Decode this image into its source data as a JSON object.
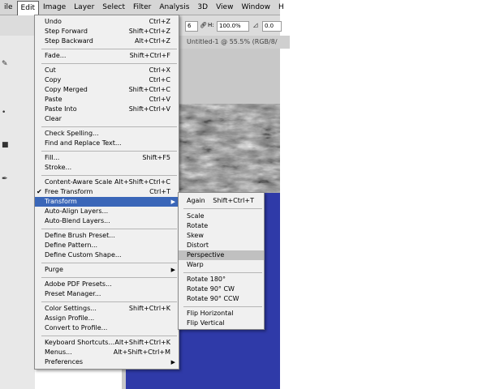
{
  "menubar": {
    "items": [
      {
        "label": "ile"
      },
      {
        "label": "Edit",
        "active": true
      },
      {
        "label": "Image"
      },
      {
        "label": "Layer"
      },
      {
        "label": "Select"
      },
      {
        "label": "Filter"
      },
      {
        "label": "Analysis"
      },
      {
        "label": "3D"
      },
      {
        "label": "View"
      },
      {
        "label": "Window"
      },
      {
        "label": "H"
      }
    ]
  },
  "options": {
    "w_value": "6",
    "h_label": "H:",
    "h_value": "100.0%",
    "angle_value": "0.0"
  },
  "document": {
    "title": "Untitled-1 @ 55.5% (RGB/8/"
  },
  "edit_menu": {
    "items": [
      {
        "label": "Undo",
        "shortcut": "Ctrl+Z"
      },
      {
        "label": "Step Forward",
        "shortcut": "Shift+Ctrl+Z"
      },
      {
        "label": "Step Backward",
        "shortcut": "Alt+Ctrl+Z"
      },
      {
        "label": "Fade...",
        "shortcut": "Shift+Ctrl+F"
      },
      {
        "label": "Cut",
        "shortcut": "Ctrl+X"
      },
      {
        "label": "Copy",
        "shortcut": "Ctrl+C"
      },
      {
        "label": "Copy Merged",
        "shortcut": "Shift+Ctrl+C"
      },
      {
        "label": "Paste",
        "shortcut": "Ctrl+V"
      },
      {
        "label": "Paste Into",
        "shortcut": "Shift+Ctrl+V"
      },
      {
        "label": "Clear",
        "shortcut": ""
      },
      {
        "label": "Check Spelling...",
        "shortcut": ""
      },
      {
        "label": "Find and Replace Text...",
        "shortcut": ""
      },
      {
        "label": "Fill...",
        "shortcut": "Shift+F5"
      },
      {
        "label": "Stroke...",
        "shortcut": ""
      },
      {
        "label": "Content-Aware Scale",
        "shortcut": "Alt+Shift+Ctrl+C"
      },
      {
        "label": "Free Transform",
        "shortcut": "Ctrl+T"
      },
      {
        "label": "Transform",
        "shortcut": ""
      },
      {
        "label": "Auto-Align Layers...",
        "shortcut": ""
      },
      {
        "label": "Auto-Blend Layers...",
        "shortcut": ""
      },
      {
        "label": "Define Brush Preset...",
        "shortcut": ""
      },
      {
        "label": "Define Pattern...",
        "shortcut": ""
      },
      {
        "label": "Define Custom Shape...",
        "shortcut": ""
      },
      {
        "label": "Purge",
        "shortcut": ""
      },
      {
        "label": "Adobe PDF Presets...",
        "shortcut": ""
      },
      {
        "label": "Preset Manager...",
        "shortcut": ""
      },
      {
        "label": "Color Settings...",
        "shortcut": "Shift+Ctrl+K"
      },
      {
        "label": "Assign Profile...",
        "shortcut": ""
      },
      {
        "label": "Convert to Profile...",
        "shortcut": ""
      },
      {
        "label": "Keyboard Shortcuts...",
        "shortcut": "Alt+Shift+Ctrl+K"
      },
      {
        "label": "Menus...",
        "shortcut": "Alt+Shift+Ctrl+M"
      },
      {
        "label": "Preferences",
        "shortcut": ""
      }
    ]
  },
  "transform_menu": {
    "items": [
      {
        "label": "Again",
        "shortcut": "Shift+Ctrl+T"
      },
      {
        "label": "Scale",
        "shortcut": ""
      },
      {
        "label": "Rotate",
        "shortcut": ""
      },
      {
        "label": "Skew",
        "shortcut": ""
      },
      {
        "label": "Distort",
        "shortcut": ""
      },
      {
        "label": "Perspective",
        "shortcut": ""
      },
      {
        "label": "Warp",
        "shortcut": ""
      },
      {
        "label": "Rotate 180°",
        "shortcut": ""
      },
      {
        "label": "Rotate 90° CW",
        "shortcut": ""
      },
      {
        "label": "Rotate 90° CCW",
        "shortcut": ""
      },
      {
        "label": "Flip Horizontal",
        "shortcut": ""
      },
      {
        "label": "Flip Vertical",
        "shortcut": ""
      }
    ]
  },
  "colors": {
    "menu_bg": "#f0f0f0",
    "highlight": "#3a66b8",
    "canvas_blue": "#2f3aa8"
  }
}
